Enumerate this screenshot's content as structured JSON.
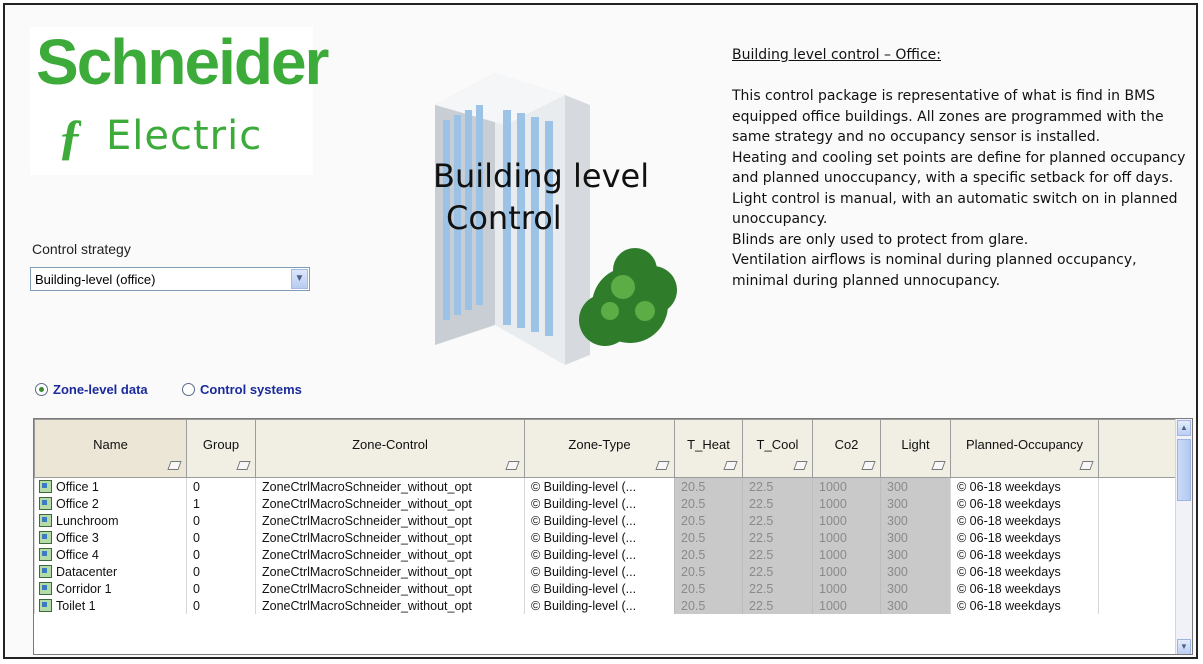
{
  "logo": {
    "line1": "Schneider",
    "line2": "Electric"
  },
  "control_strategy": {
    "label": "Control strategy",
    "selected": "Building-level (office)"
  },
  "building": {
    "title_line1": "Building level",
    "title_line2": "Control"
  },
  "description": {
    "title": "Building level control – Office:",
    "paragraphs": [
      "This control package is representative of what is find in BMS equipped office buildings.  All zones are programmed with the same strategy and no occupancy sensor is installed.",
      "Heating and cooling set points are define for planned occupancy and planned unoccupancy, with a specific setback for off days.",
      "Light control is manual, with an automatic switch on in planned unoccupancy.",
      "Blinds are only used to protect from glare.",
      "Ventilation airflows is nominal during planned occupancy, minimal during planned unnocupancy."
    ]
  },
  "view_options": [
    {
      "label": "Zone-level data",
      "selected": true
    },
    {
      "label": "Control systems",
      "selected": false
    }
  ],
  "table": {
    "columns": [
      "Name",
      "Group",
      "Zone-Control",
      "Zone-Type",
      "T_Heat",
      "T_Cool",
      "Co2",
      "Light",
      "Planned-Occupancy"
    ],
    "rows": [
      [
        "Office 1",
        "0",
        "ZoneCtrlMacroSchneider_without_opt",
        "© Building-level (...",
        "20.5",
        "22.5",
        "1000",
        "300",
        "© 06-18 weekdays"
      ],
      [
        "Office 2",
        "1",
        "ZoneCtrlMacroSchneider_without_opt",
        "© Building-level (...",
        "20.5",
        "22.5",
        "1000",
        "300",
        "© 06-18 weekdays"
      ],
      [
        "Lunchroom",
        "0",
        "ZoneCtrlMacroSchneider_without_opt",
        "© Building-level (...",
        "20.5",
        "22.5",
        "1000",
        "300",
        "© 06-18 weekdays"
      ],
      [
        "Office 3",
        "0",
        "ZoneCtrlMacroSchneider_without_opt",
        "© Building-level (...",
        "20.5",
        "22.5",
        "1000",
        "300",
        "© 06-18 weekdays"
      ],
      [
        "Office 4",
        "0",
        "ZoneCtrlMacroSchneider_without_opt",
        "© Building-level (...",
        "20.5",
        "22.5",
        "1000",
        "300",
        "© 06-18 weekdays"
      ],
      [
        "Datacenter",
        "0",
        "ZoneCtrlMacroSchneider_without_opt",
        "© Building-level (...",
        "20.5",
        "22.5",
        "1000",
        "300",
        "© 06-18 weekdays"
      ],
      [
        "Corridor 1",
        "0",
        "ZoneCtrlMacroSchneider_without_opt",
        "© Building-level (...",
        "20.5",
        "22.5",
        "1000",
        "300",
        "© 06-18 weekdays"
      ],
      [
        "Toilet 1",
        "0",
        "ZoneCtrlMacroSchneider_without_opt",
        "© Building-level (...",
        "20.5",
        "22.5",
        "1000",
        "300",
        "© 06-18 weekdays"
      ]
    ]
  },
  "colors": {
    "brand_green": "#3dab3a",
    "header_bg": "#f1eee4",
    "disabled_cell": "#c9c9c9",
    "radio_text": "#1a2a9c"
  },
  "icons": {
    "zone_row": "zone-icon",
    "sort": "sort-icon",
    "dropdown": "chevron-down-icon",
    "scroll_up": "scroll-up-icon",
    "scroll_down": "scroll-down-icon"
  }
}
